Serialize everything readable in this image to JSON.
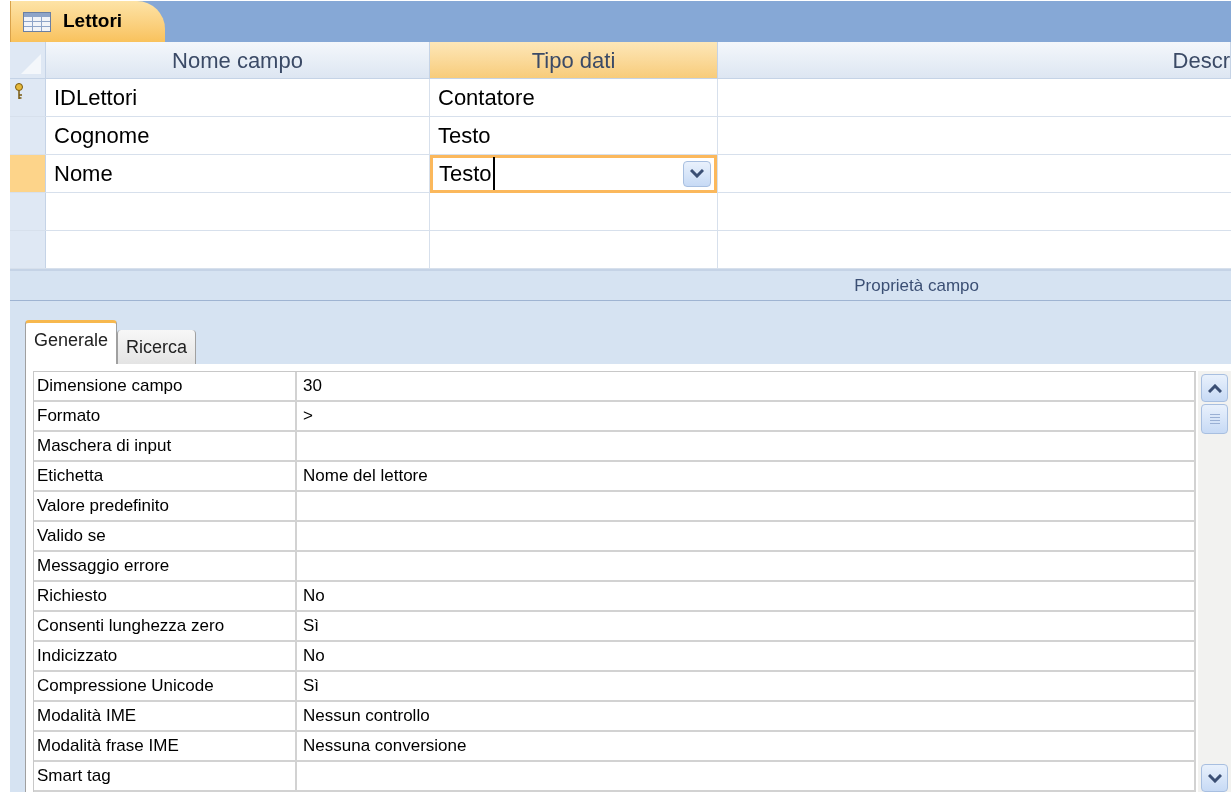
{
  "document_tab": {
    "title": "Lettori"
  },
  "design_grid": {
    "columns": [
      "Nome campo",
      "Tipo dati",
      "Descr"
    ],
    "rows": [
      {
        "field_name": "IDLettori",
        "data_type": "Contatore",
        "primary_key": true,
        "selected": false
      },
      {
        "field_name": "Cognome",
        "data_type": "Testo",
        "primary_key": false,
        "selected": false
      },
      {
        "field_name": "Nome",
        "data_type": "Testo",
        "primary_key": false,
        "selected": true
      },
      {
        "field_name": "",
        "data_type": "",
        "primary_key": false,
        "selected": false
      },
      {
        "field_name": "",
        "data_type": "",
        "primary_key": false,
        "selected": false
      }
    ]
  },
  "field_properties": {
    "title": "Proprietà campo",
    "tabs": [
      {
        "label": "Generale",
        "selected": true
      },
      {
        "label": "Ricerca",
        "selected": false
      }
    ],
    "rows": [
      {
        "label": "Dimensione campo",
        "value": "30"
      },
      {
        "label": "Formato",
        "value": ">"
      },
      {
        "label": "Maschera di input",
        "value": ""
      },
      {
        "label": "Etichetta",
        "value": "Nome del lettore"
      },
      {
        "label": "Valore predefinito",
        "value": ""
      },
      {
        "label": "Valido se",
        "value": ""
      },
      {
        "label": "Messaggio errore",
        "value": ""
      },
      {
        "label": "Richiesto",
        "value": "No"
      },
      {
        "label": "Consenti lunghezza zero",
        "value": "Sì"
      },
      {
        "label": "Indicizzato",
        "value": "No"
      },
      {
        "label": "Compressione Unicode",
        "value": "Sì"
      },
      {
        "label": "Modalità IME",
        "value": "Nessun controllo"
      },
      {
        "label": "Modalità frase IME",
        "value": "Nessuna conversione"
      },
      {
        "label": "Smart tag",
        "value": ""
      }
    ]
  }
}
